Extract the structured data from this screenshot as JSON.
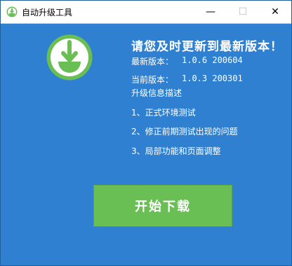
{
  "window": {
    "title": "自动升级工具",
    "controls": {
      "minimize": "—",
      "maximize": "☐",
      "close": "✕"
    }
  },
  "logo": {
    "icon": "download-icon",
    "circle_color": "#ffffff",
    "accent": "#6abf54"
  },
  "header": {
    "headline": "请您及时更新到最新版本！"
  },
  "versions": {
    "latest_label": "最新版本：",
    "latest_value": "1.0.6 200604",
    "current_label": "当前版本：",
    "current_value": "1.0.3 200301"
  },
  "notes": {
    "title": "升级信息描述",
    "items": [
      "1、正式环境测试",
      "2、修正前期测试出现的问题",
      "3、局部功能和页面调整"
    ]
  },
  "actions": {
    "download_label": "开始下载"
  },
  "colors": {
    "background": "#2f80d1",
    "button": "#6abf54",
    "text": "#ffffff"
  }
}
